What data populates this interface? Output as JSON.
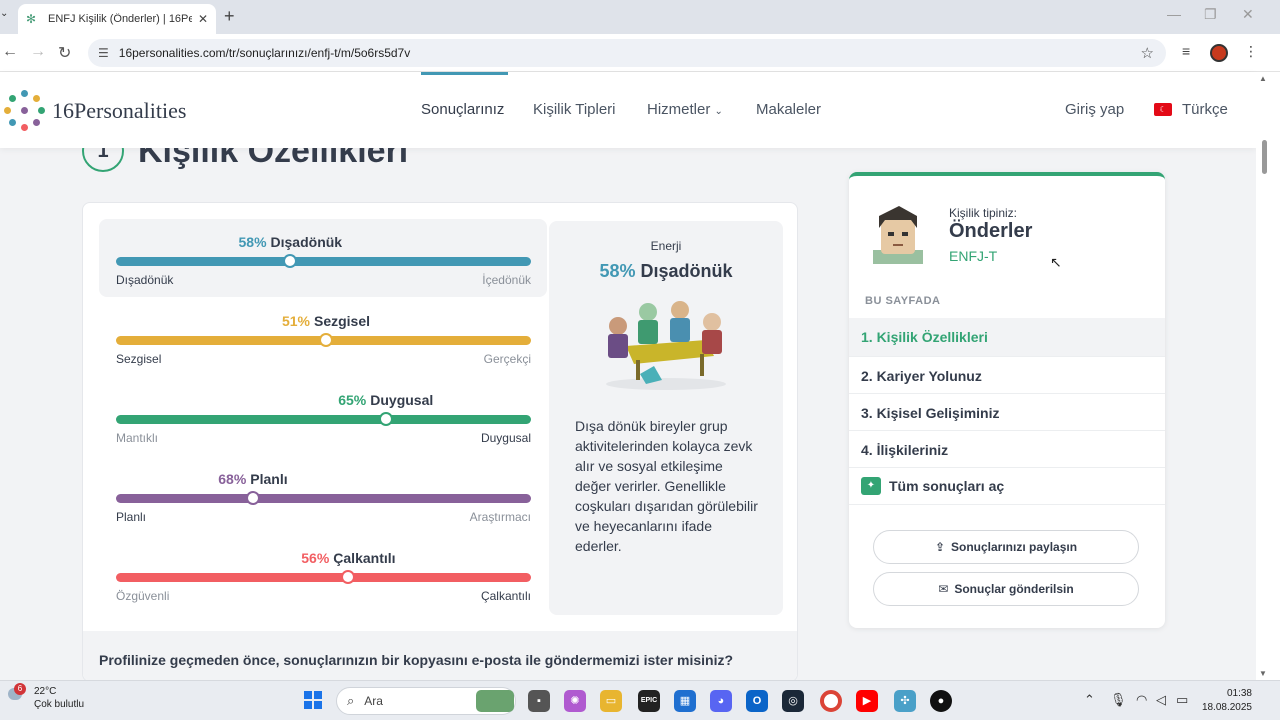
{
  "browser": {
    "tab_title": "ENFJ Kişilik (Önderler) | 16Perso",
    "url": "16personalities.com/tr/sonuçlarınızı/enfj-t/m/5o6rs5d7v"
  },
  "site": {
    "logo_number": "16",
    "logo_word": "Personalities",
    "nav": {
      "results": "Sonuçlarınız",
      "types": "Kişilik Tipleri",
      "services": "Hizmetler",
      "articles": "Makaleler",
      "login": "Giriş yap",
      "language": "Türkçe"
    }
  },
  "section": {
    "number": "1",
    "title": "Kişilik Özellikleri"
  },
  "traits": [
    {
      "percent": "58%",
      "name": "Dışadönük",
      "left": "Dışadönük",
      "right": "İçedönük",
      "value": 0.42,
      "color": "#4298b4"
    },
    {
      "percent": "51%",
      "name": "Sezgisel",
      "left": "Sezgisel",
      "right": "Gerçekçi",
      "value": 0.506,
      "color": "#e4ae3a"
    },
    {
      "percent": "65%",
      "name": "Duygusal",
      "left": "Mantıklı",
      "right": "Duygusal",
      "value": 0.65,
      "color": "#33a474"
    },
    {
      "percent": "68%",
      "name": "Planlı",
      "left": "Planlı",
      "right": "Araştırmacı",
      "value": 0.33,
      "color": "#88619a"
    },
    {
      "percent": "56%",
      "name": "Çalkantılı",
      "left": "Özgüvenli",
      "right": "Çalkantılı",
      "value": 0.56,
      "color": "#f25e62"
    }
  ],
  "detail": {
    "category": "Enerji",
    "percent": "58%",
    "name": "Dışadönük",
    "description": "Dışa dönük bireyler grup aktivitelerinden kolayca zevk alır ve sosyal etkileşime değer verirler. Genellikle coşkuları dışarıdan görülebilir ve heyecanlarını ifade ederler."
  },
  "email_prompt": "Profilinize geçmeden önce, sonuçlarınızın bir kopyasını e-posta ile göndermemizi ister misiniz?",
  "panel": {
    "your_type_label": "Kişilik tipiniz:",
    "type_name": "Önderler",
    "type_code": "ENFJ-T",
    "on_page": "BU SAYFADA",
    "toc": [
      "1. Kişilik Özellikleri",
      "2. Kariyer Yolunuz",
      "3. Kişisel Gelişiminiz",
      "4. İlişkileriniz"
    ],
    "unlock": "Tüm sonuçları aç",
    "share": "Sonuçlarınızı paylaşın",
    "email": "Sonuçlar gönderilsin"
  },
  "taskbar": {
    "weather_badge": "6",
    "temperature": "22°C",
    "weather_desc": "Çok bulutlu",
    "search": "Ara",
    "time": "01:38",
    "date": "18.08.2025"
  }
}
